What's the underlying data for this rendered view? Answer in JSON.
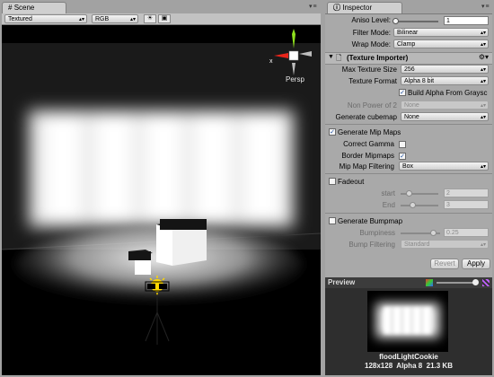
{
  "scene": {
    "tab_label": "Scene",
    "draw_mode": "Textured",
    "render_mode": "RGB",
    "gizmo_label": "Persp",
    "gizmo_x_label": "x",
    "toolbar_icons": [
      "sun-icon",
      "image-icon"
    ]
  },
  "inspector": {
    "tab_label": "Inspector",
    "aniso_level": {
      "label": "Aniso Level:",
      "value": "1"
    },
    "filter_mode": {
      "label": "Filter Mode:",
      "value": "Bilinear"
    },
    "wrap_mode": {
      "label": "Wrap Mode:",
      "value": "Clamp"
    },
    "importer_title": "(Texture Importer)",
    "max_texture_size": {
      "label": "Max Texture Size",
      "value": "256"
    },
    "texture_format": {
      "label": "Texture Format",
      "value": "Alpha 8 bit"
    },
    "build_alpha": {
      "label": "Build Alpha From Graysc",
      "checked": true
    },
    "non_power_of_2": {
      "label": "Non Power of 2",
      "value": "None"
    },
    "generate_cubemap": {
      "label": "Generate cubemap",
      "value": "None"
    },
    "generate_mip_maps": {
      "label": "Generate Mip Maps",
      "checked": true
    },
    "correct_gamma": {
      "label": "Correct Gamma",
      "checked": false
    },
    "border_mipmaps": {
      "label": "Border Mipmaps",
      "checked": true
    },
    "mip_map_filtering": {
      "label": "Mip Map Filtering",
      "value": "Box"
    },
    "fadeout": {
      "label": "Fadeout",
      "checked": false
    },
    "fade_start": {
      "label": "start",
      "value": "2"
    },
    "fade_end": {
      "label": "End",
      "value": "3"
    },
    "generate_bumpmap": {
      "label": "Generate Bumpmap",
      "checked": false
    },
    "bumpiness": {
      "label": "Bumpiness",
      "value": "0.25"
    },
    "bump_filtering": {
      "label": "Bump Filtering",
      "value": "Standard"
    },
    "revert_label": "Revert",
    "apply_label": "Apply"
  },
  "preview": {
    "title": "Preview",
    "texture_name": "floodLightCookie",
    "texture_info": "128x128  Alpha 8  21.3 KB"
  },
  "colors": {
    "panel": "#a2a2a2",
    "tab": "#cfcfcf",
    "viewport": "#000000",
    "preview_header": "#3c3c3c",
    "check_blue": "#1a4da0"
  }
}
